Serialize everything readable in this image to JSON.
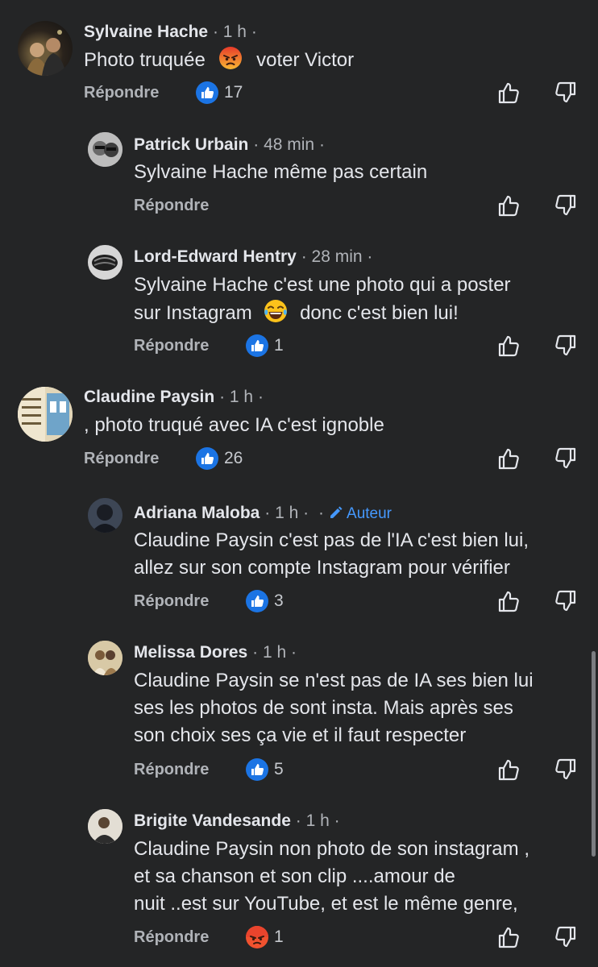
{
  "comments": [
    {
      "name": "Sylvaine Hache",
      "time": "1 h",
      "text_a": "Photo truquée",
      "text_b": "voter Victor",
      "reply": "Répondre",
      "reaction": "like",
      "count": "17"
    },
    {
      "name": "Patrick Urbain",
      "time": "48 min",
      "text": "Sylvaine Hache même pas certain",
      "reply": "Répondre"
    },
    {
      "name": "Lord-Edward Hentry",
      "time": "28 min",
      "line1": "Sylvaine Hache c'est une photo qui a poster",
      "line2_a": "sur Instagram",
      "line2_b": "donc c'est bien lui!",
      "reply": "Répondre",
      "reaction": "like",
      "count": "1"
    },
    {
      "name": "Claudine Paysin",
      "time": "1 h",
      "text": ", photo truqué  avec IA   c'est ignoble",
      "reply": "Répondre",
      "reaction": "like",
      "count": "26"
    },
    {
      "name": "Adriana Maloba",
      "time": "1 h",
      "badge": "Auteur",
      "line1": "Claudine Paysin c'est pas de l'IA c'est bien lui,",
      "line2": "allez sur son compte Instagram pour vérifier",
      "reply": "Répondre",
      "reaction": "like",
      "count": "3"
    },
    {
      "name": "Melissa Dores",
      "time": "1 h",
      "line1": "Claudine Paysin se n'est pas de IA ses bien lui",
      "line2": "ses les photos de sont insta. Mais après ses",
      "line3": "son choix ses ça vie et il faut respecter",
      "reply": "Répondre",
      "reaction": "like",
      "count": "5"
    },
    {
      "name": "Brigite Vandesande",
      "time": "1 h",
      "line1": "Claudine Paysin non photo  de son instagram  ,",
      "line2": "et sa chanson  et son clip ....amour de",
      "line3": "nuit  ..est sur YouTube,  et est  le même  genre,",
      "reply": "Répondre",
      "reaction": "angry",
      "count": "1"
    }
  ],
  "separator": "·",
  "icons": {
    "like_reaction": "like-reaction-icon",
    "angry_reaction": "angry-reaction-icon",
    "upvote": "thumbs-up-outline-icon",
    "downvote": "thumbs-down-outline-icon",
    "author": "pencil-icon"
  },
  "colors": {
    "background": "#242526",
    "accent": "#4599ff",
    "secondary_text": "#b0b3b8"
  }
}
